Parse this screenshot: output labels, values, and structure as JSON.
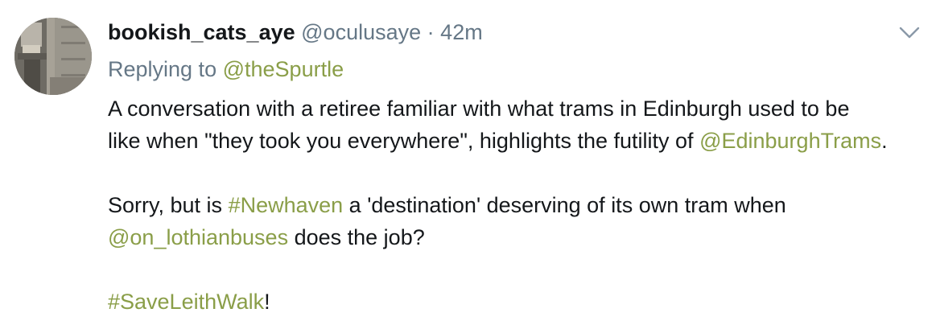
{
  "tweet": {
    "username": "bookish_cats_aye",
    "handle": "@oculusaye",
    "separator": "·",
    "time": "42m",
    "replying_prefix": "Replying to",
    "replying_to": "@theSpurtle",
    "body": {
      "p1_line1": "A conversation with a retiree familiar with what trams in Edinburgh used to be",
      "p1_line2_text": "like when \"they took you everywhere\", highlights the futility of",
      "p1_mention": "@EdinburghTrams",
      "p1_end": ".",
      "p2_text1": "Sorry, but is",
      "p2_hashtag": "#Newhaven",
      "p2_text2": "a 'destination' deserving of its own tram when",
      "p2_mention": "@on_lothianbuses",
      "p2_text3": "does the job?",
      "p3_hashtag": "#SaveLeithWalk",
      "p3_end": "!"
    }
  },
  "icons": {
    "menu": "chevron-down-icon",
    "avatar": "avatar"
  },
  "colors": {
    "text": "#14171a",
    "secondary": "#657786",
    "link": "#8a9e48"
  }
}
